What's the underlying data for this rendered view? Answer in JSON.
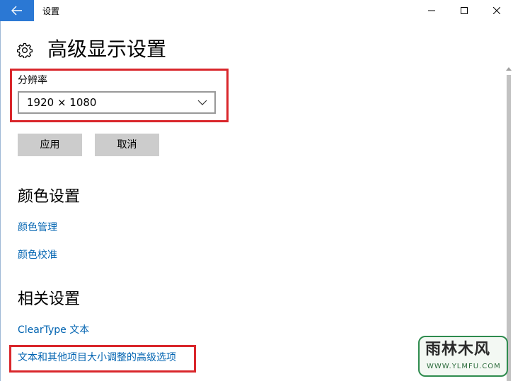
{
  "window": {
    "title": "设置",
    "back_icon": "arrow-left-icon",
    "accent_color": "#2b78d4",
    "controls": [
      "minimize-icon",
      "maximize-icon",
      "close-icon"
    ]
  },
  "page": {
    "title": "高级显示设置",
    "title_icon": "gear-icon"
  },
  "resolution": {
    "label": "分辨率",
    "value": "1920 × 1080",
    "highlight_color": "#d9262b"
  },
  "buttons": {
    "apply_label": "应用",
    "cancel_label": "取消"
  },
  "color_settings": {
    "title": "颜色设置",
    "links": [
      "颜色管理",
      "颜色校准"
    ]
  },
  "related_settings": {
    "title": "相关设置",
    "links": [
      "ClearType 文本",
      "文本和其他项目大小调整的高级选项"
    ]
  },
  "link_color": "#0063b1",
  "watermark": {
    "main": "雨林木风",
    "sub": "WWW.YLMFU.COM"
  }
}
